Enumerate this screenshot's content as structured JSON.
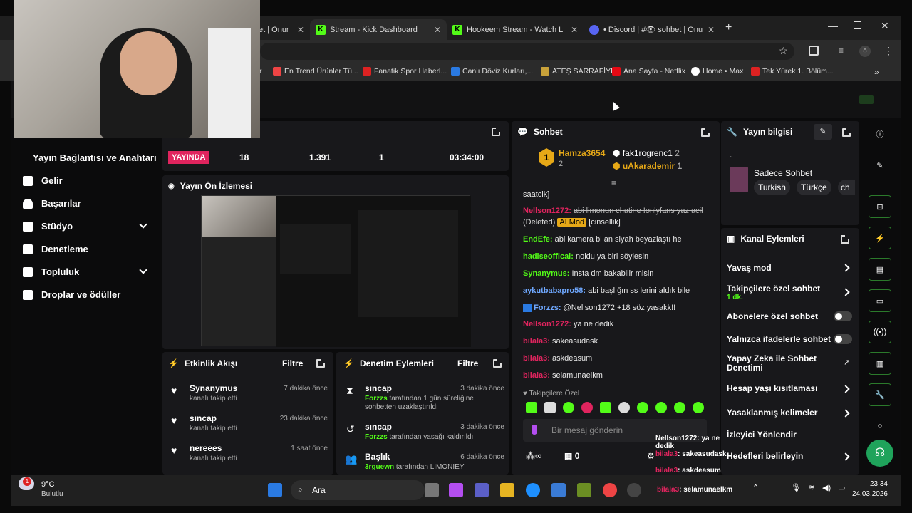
{
  "tabs": [
    {
      "label": "et | Onur"
    },
    {
      "label": "Stream - Kick Dashboard"
    },
    {
      "label": "Hookeem Stream - Watch Live"
    },
    {
      "label": "• Discord | #👁 sohbet | Onur"
    }
  ],
  "profile_letter": "0",
  "bookmarks": [
    "En Trend Ürünler Tü...",
    "Fanatik Spor Haberl...",
    "Canlı Döviz Kurları,...",
    "ATEŞ SARRAFİYE",
    "Ana Sayfa - Netflix",
    "Home • Max",
    "Tek Yürek 1. Bölüm..."
  ],
  "sidebar": {
    "items": [
      {
        "label": "Yayın Bağlantısı ve Anahtarı"
      },
      {
        "label": "Gelir"
      },
      {
        "label": "Başarılar"
      },
      {
        "label": "Stüdyo"
      },
      {
        "label": "Denetleme"
      },
      {
        "label": "Topluluk"
      },
      {
        "label": "Droplar ve ödüller"
      }
    ]
  },
  "stats": {
    "live": "YAYINDA",
    "v1": "18",
    "v2": "1.391",
    "v3": "1",
    "v4": "03:34:00"
  },
  "preview": {
    "title": "Yayın Ön İzlemesi"
  },
  "activity": {
    "title": "Etkinlik Akışı",
    "filter": "Filtre",
    "items": [
      {
        "name": "Synanymus",
        "sub": "kanalı takip etti",
        "time": "7 dakika önce"
      },
      {
        "name": "sıncap",
        "sub": "kanalı takip etti",
        "time": "23 dakika önce"
      },
      {
        "name": "nereees",
        "sub": "kanalı takip etti",
        "time": "1 saat önce"
      }
    ]
  },
  "moderation": {
    "title": "Denetim Eylemleri",
    "filter": "Filtre",
    "items": [
      {
        "name": "sıncap",
        "time": "3 dakika önce",
        "by": "Forzzs",
        "desc": "tarafından 1 gün süreliğine sohbetten uzaklaştırıldı"
      },
      {
        "name": "sıncap",
        "time": "3 dakika önce",
        "by": "Forzzs",
        "desc": "tarafından yasağı kaldırıldı"
      },
      {
        "name": "Başlık",
        "time": "6 dakika önce",
        "by": "3rguewn",
        "desc": "tarafından LIMONIEY"
      }
    ]
  },
  "chat": {
    "title": "Sohbet",
    "top": {
      "rank1": "Hamza3654",
      "rank1_count": "2",
      "user2": "fak1rogrenc1",
      "user2_count": "2",
      "user3": "uAkarademir",
      "user3_count": "1",
      "badge": "1"
    },
    "messages": [
      {
        "user": "",
        "text": "saatcik]"
      },
      {
        "user": "Nellson1272:",
        "text": "abi limonun chatine !onlyfans yaz acil",
        "deleted": "(Deleted)",
        "aimod": "AI Mod",
        "tag": "[cinsellik]"
      },
      {
        "user": "EndEfe:",
        "text": "abi kamera bi an siyah beyazlaştı he"
      },
      {
        "user": "hadiseoffical:",
        "text": "noldu ya biri söylesin"
      },
      {
        "user": "Synanymus:",
        "text": "Insta dm bakabilir misin"
      },
      {
        "user": "aykutbabapro58:",
        "text": "abi başlığın ss lerini aldık bile"
      },
      {
        "user": "Forzzs:",
        "text": "@Nellson1272 +18 söz yasakk!!"
      },
      {
        "user": "Nellson1272:",
        "text": "ya ne dedik"
      },
      {
        "user": "bilala3:",
        "text": "sakeasudask"
      },
      {
        "user": "bilala3:",
        "text": "askdeasum"
      },
      {
        "user": "bilala3:",
        "text": "selamunaelkm"
      }
    ],
    "followers_only": "Takipçilere Özel",
    "input_placeholder": "Bir mesaj gönderin",
    "bottom_count": "0"
  },
  "stream_info": {
    "title": "Yayın bilgisi",
    "dot": ".",
    "category": "Sadece Sohbet",
    "tags": [
      "Turkish",
      "Türkçe",
      "ch"
    ]
  },
  "channel_actions": {
    "title": "Kanal Eylemleri",
    "items": [
      {
        "label": "Yavaş mod"
      },
      {
        "label": "Takipçilere özel sohbet",
        "sub": "1 dk."
      },
      {
        "label": "Abonelere özel sohbet"
      },
      {
        "label": "Yalnızca ifadelerle sohbet"
      },
      {
        "label": "Yapay Zeka ile Sohbet Denetimi"
      },
      {
        "label": "Hesap yaşı kısıtlaması"
      },
      {
        "label": "Yasaklanmış kelimeler"
      },
      {
        "label": "İzleyici Yönlendir"
      },
      {
        "label": "Hedefleri belirleyin"
      }
    ]
  },
  "overlay": [
    {
      "user": "Nellson1272",
      "text": ": ya ne dedik"
    },
    {
      "user": "bilala3",
      "text": ": sakeasudask"
    },
    {
      "user": "bilala3",
      "text": ": askdeasum"
    },
    {
      "user": "bilala3",
      "text": ": selamunaelkm"
    }
  ],
  "taskbar": {
    "temp": "9°C",
    "weather": "Bulutlu",
    "search": "Ara",
    "time": "23:34",
    "date": "24.03.2026",
    "notif": "1"
  },
  "colors": {
    "accent": "#53fc18",
    "live": "#e0245e",
    "panel": "#18181b"
  }
}
